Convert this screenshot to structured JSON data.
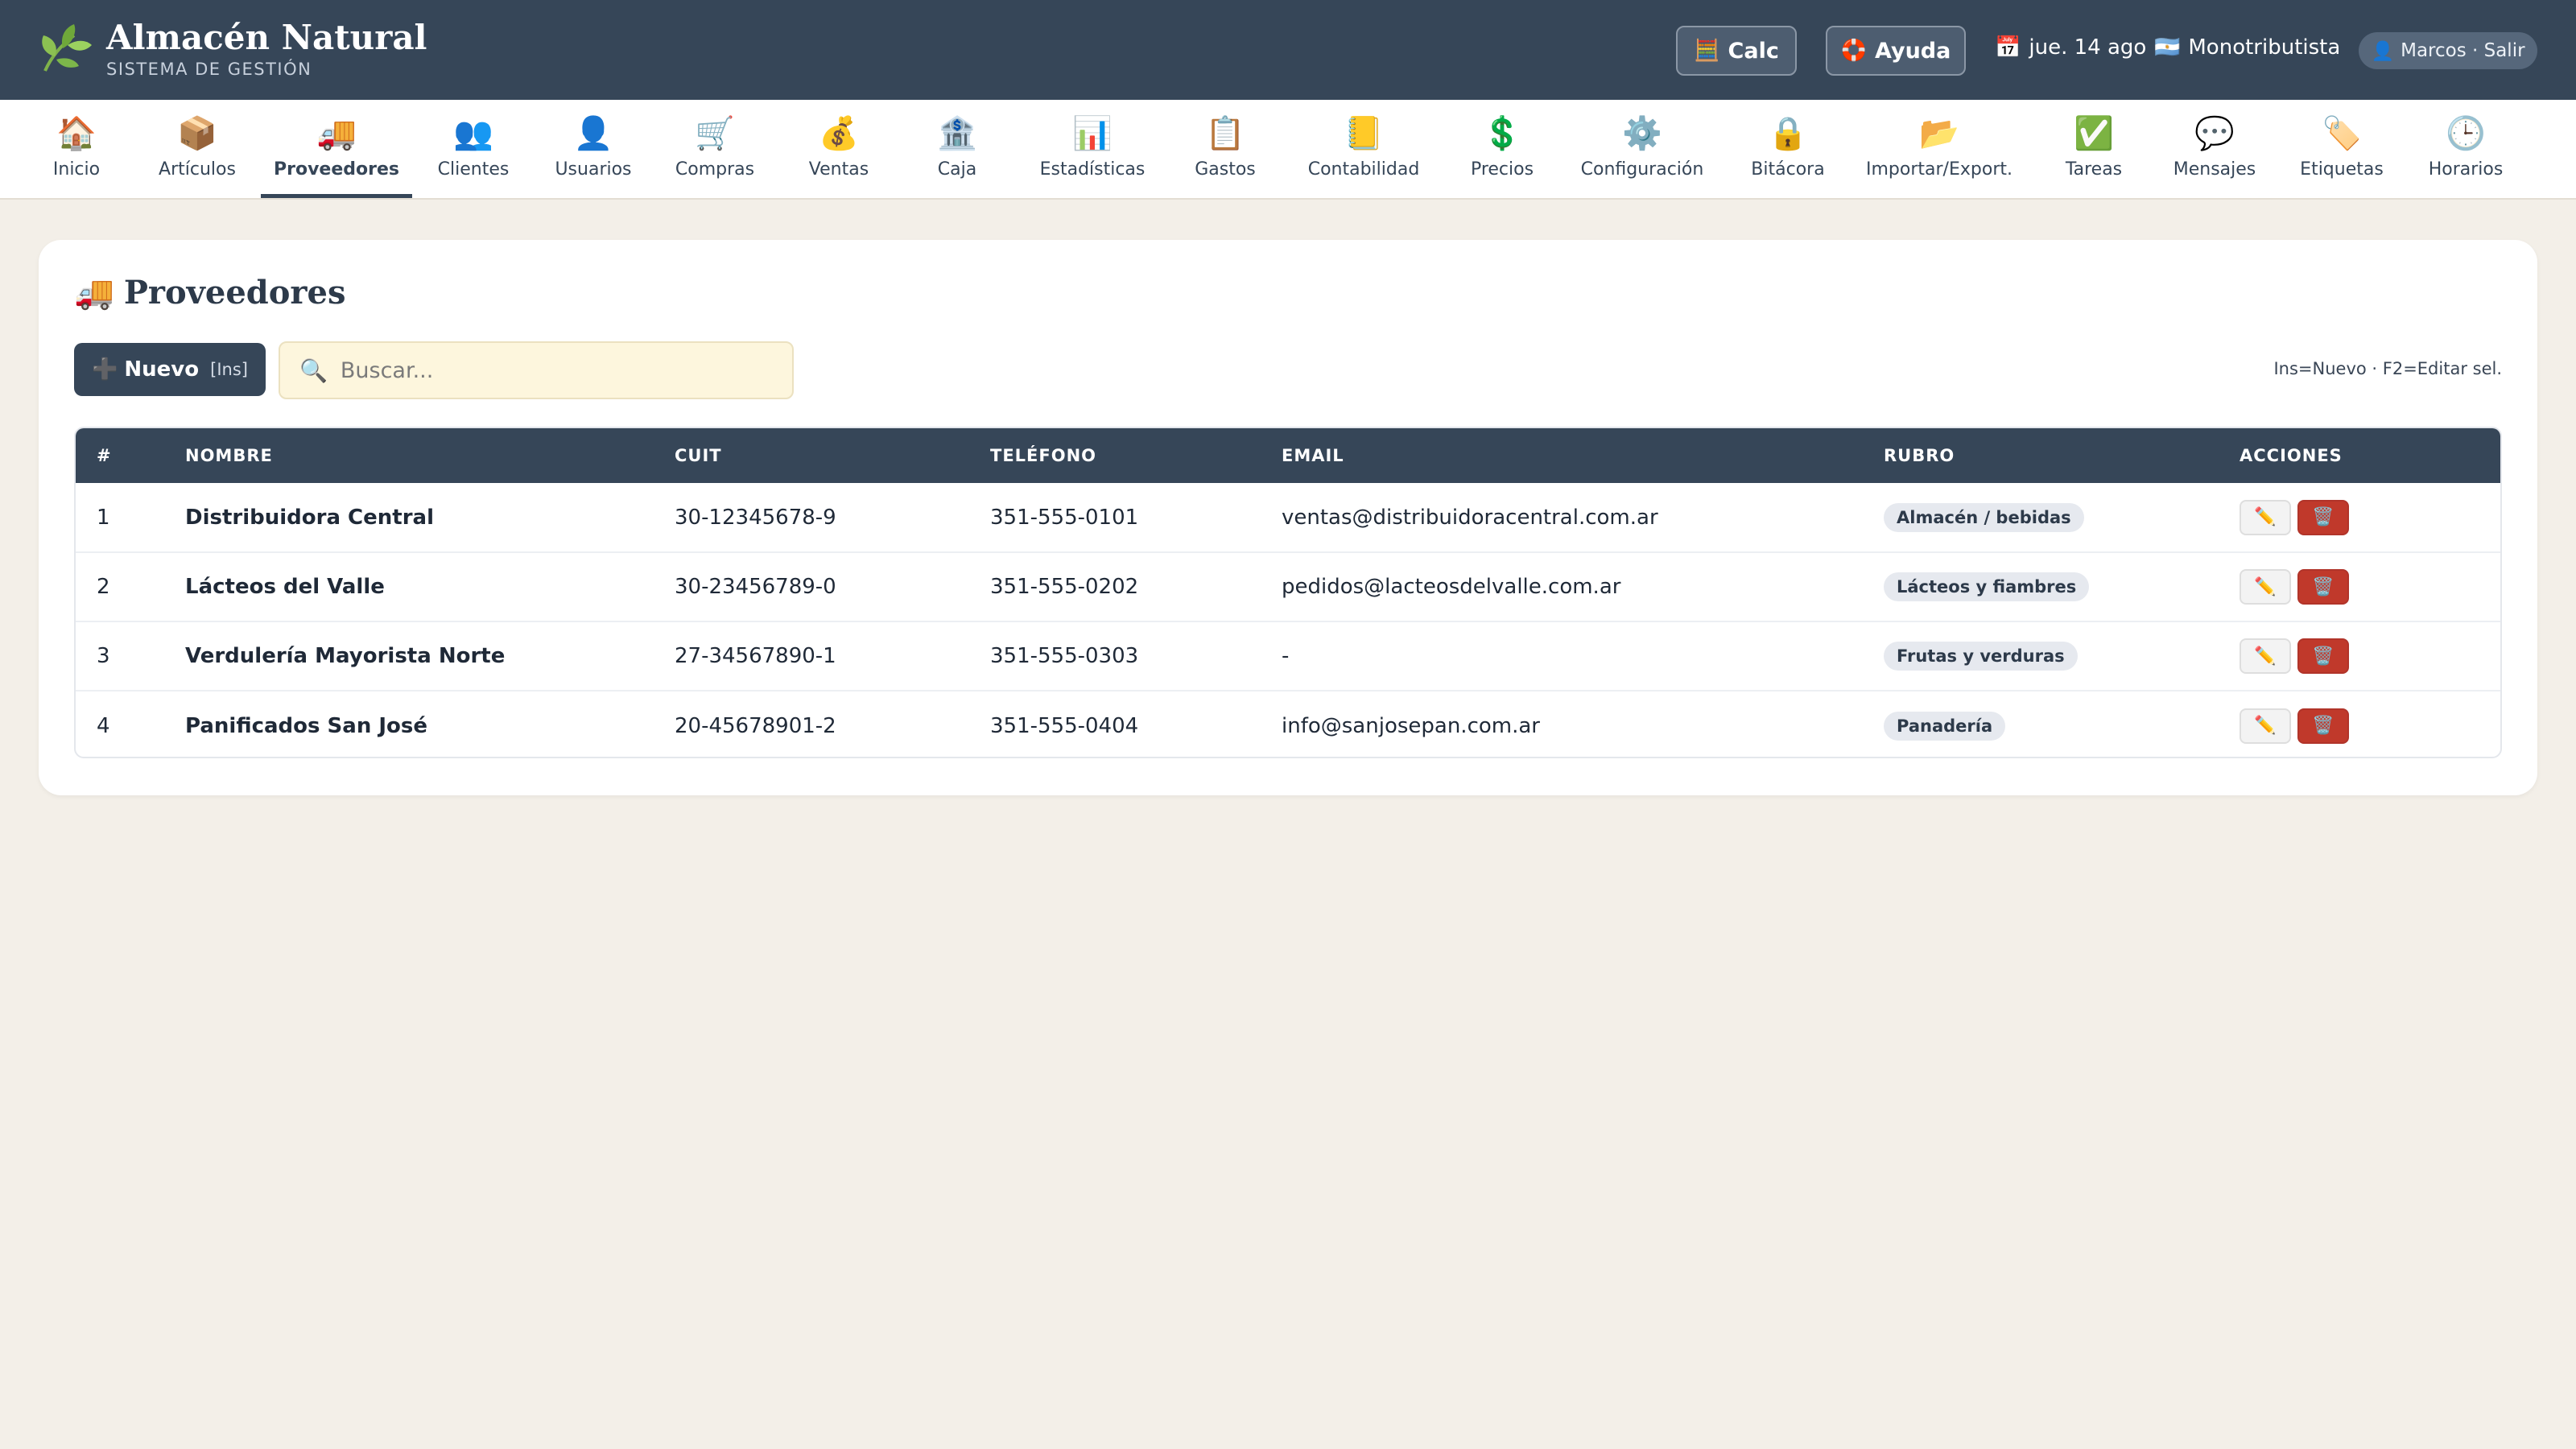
{
  "header": {
    "brand": "Almacén Natural",
    "subtitle": "SISTEMA DE GESTIÓN",
    "calc_label": "Calc",
    "help_label": "Ayuda",
    "date": "jue. 14 ago",
    "fiscal_status": "Monotributista",
    "user": "Marcos · Salir"
  },
  "nav": {
    "items": [
      {
        "label": "Inicio",
        "icon": "🏠"
      },
      {
        "label": "Artículos",
        "icon": "📦"
      },
      {
        "label": "Proveedores",
        "icon": "🚚"
      },
      {
        "label": "Clientes",
        "icon": "👥"
      },
      {
        "label": "Usuarios",
        "icon": "👤"
      },
      {
        "label": "Compras",
        "icon": "🛒"
      },
      {
        "label": "Ventas",
        "icon": "💰"
      },
      {
        "label": "Caja",
        "icon": "🏦"
      },
      {
        "label": "Estadísticas",
        "icon": "📊"
      },
      {
        "label": "Gastos",
        "icon": "📋"
      },
      {
        "label": "Contabilidad",
        "icon": "📒"
      },
      {
        "label": "Precios",
        "icon": "💲"
      },
      {
        "label": "Configuración",
        "icon": "⚙️"
      },
      {
        "label": "Bitácora",
        "icon": "🔒"
      },
      {
        "label": "Importar/Export.",
        "icon": "📂"
      },
      {
        "label": "Tareas",
        "icon": "✅"
      },
      {
        "label": "Mensajes",
        "icon": "💬"
      },
      {
        "label": "Etiquetas",
        "icon": "🏷️"
      },
      {
        "label": "Horarios",
        "icon": "🕒"
      }
    ],
    "active": "Proveedores"
  },
  "main": {
    "title": "Proveedores",
    "new_label": "Nuevo",
    "new_shortcut": "[Ins]",
    "search_placeholder": "Buscar...",
    "shortcuts_hint": "Ins=Nuevo · F2=Editar sel."
  },
  "table": {
    "columns": [
      "#",
      "NOMBRE",
      "CUIT",
      "TELÉFONO",
      "EMAIL",
      "RUBRO",
      "ACCIONES"
    ],
    "rows": [
      {
        "id": "1",
        "name": "Distribuidora Central",
        "cuit": "30-12345678-9",
        "phone": "351-555-0101",
        "email": "ventas@distribuidoracentral.com.ar",
        "rubro": "Almacén / bebidas"
      },
      {
        "id": "2",
        "name": "Lácteos del Valle",
        "cuit": "30-23456789-0",
        "phone": "351-555-0202",
        "email": "pedidos@lacteosdelvalle.com.ar",
        "rubro": "Lácteos y fiambres"
      },
      {
        "id": "3",
        "name": "Verdulería Mayorista Norte",
        "cuit": "27-34567890-1",
        "phone": "351-555-0303",
        "email": "-",
        "rubro": "Frutas y verduras"
      },
      {
        "id": "4",
        "name": "Panificados San José",
        "cuit": "20-45678901-2",
        "phone": "351-555-0404",
        "email": "info@sanjosepan.com.ar",
        "rubro": "Panadería"
      }
    ]
  }
}
